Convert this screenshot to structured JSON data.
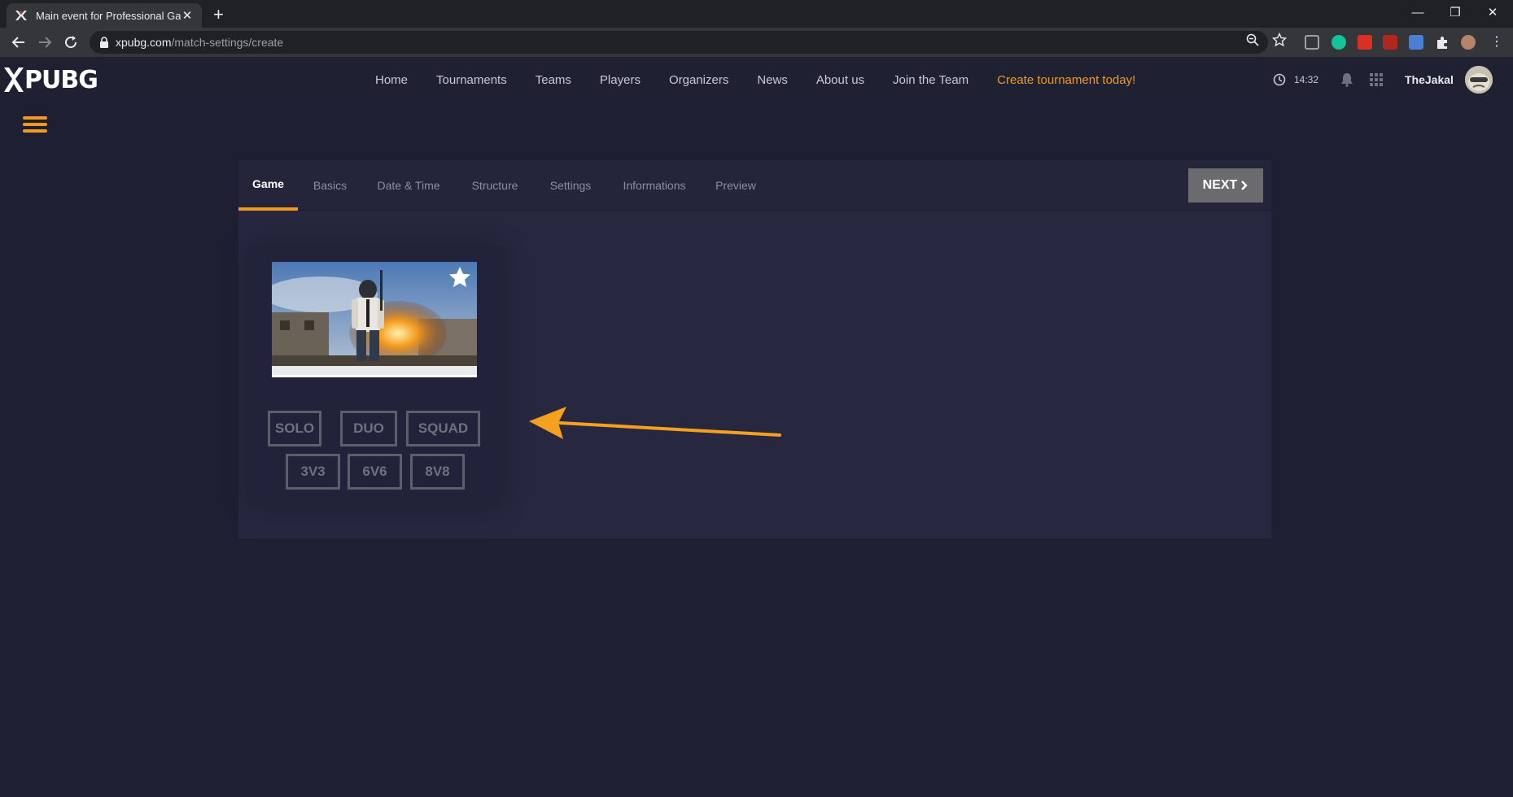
{
  "browser": {
    "tab_title": "Main event for Professional Gam",
    "url_host": "xpubg.com",
    "url_path": "/match-settings/create"
  },
  "site": {
    "logo_text": "PUBG",
    "nav": [
      "Home",
      "Tournaments",
      "Teams",
      "Players",
      "Organizers",
      "News",
      "About us",
      "Join the Team",
      "Create tournament today!"
    ],
    "time": "14:32",
    "username": "TheJakal",
    "accent_color": "#f39a1e"
  },
  "wizard": {
    "steps": [
      "Game",
      "Basics",
      "Date & Time",
      "Structure",
      "Settings",
      "Informations",
      "Preview"
    ],
    "active_step": "Game",
    "next_label": "NEXT",
    "modes_row1": [
      "SOLO",
      "DUO",
      "SQUAD"
    ],
    "modes_row2": [
      "3V3",
      "6V6",
      "8V8"
    ]
  }
}
